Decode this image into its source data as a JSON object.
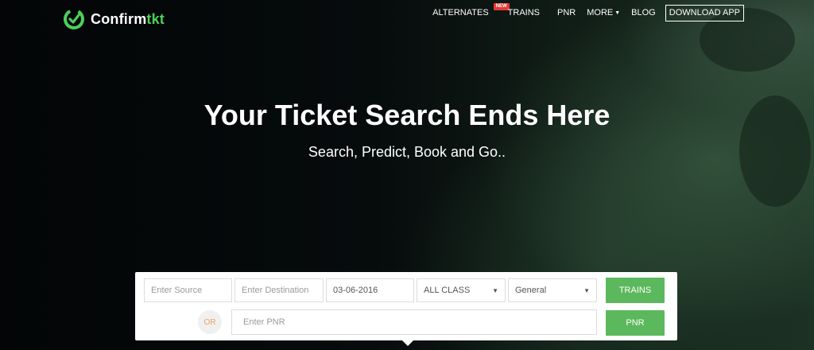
{
  "brand": {
    "name_main": "Confirm",
    "name_accent": "tkt",
    "accent_color": "#4cd05a"
  },
  "nav": {
    "alternates": "ALTERNATES",
    "alternates_badge": "NEW",
    "trains": "TRAINS",
    "pnr": "PNR",
    "more": "MORE",
    "blog": "BLOG",
    "download": "DOWNLOAD APP"
  },
  "hero": {
    "title": "Your Ticket Search Ends Here",
    "subtitle": "Search, Predict, Book and Go.."
  },
  "search": {
    "source_placeholder": "Enter Source",
    "destination_placeholder": "Enter Destination",
    "date_value": "03-06-2016",
    "class_value": "ALL CLASS",
    "quota_value": "General",
    "trains_button": "TRAINS",
    "or_label": "OR",
    "pnr_placeholder": "Enter PNR",
    "pnr_button": "PNR",
    "button_color": "#5cb85c"
  }
}
